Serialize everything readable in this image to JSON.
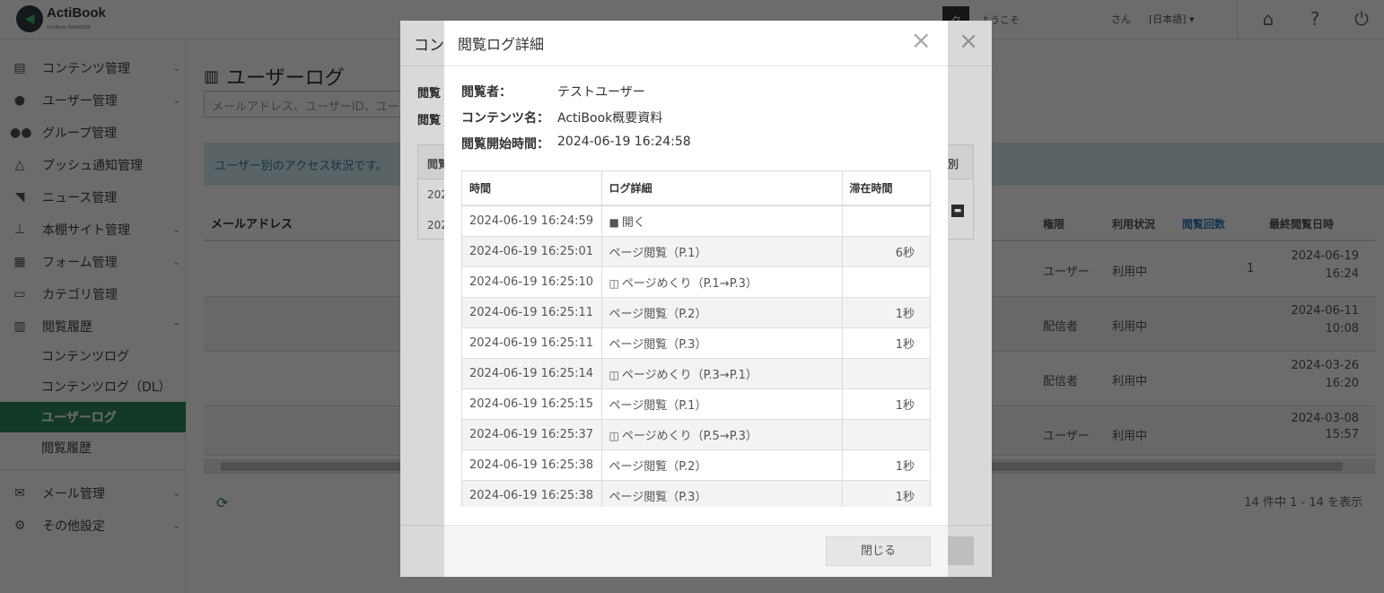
{
  "header": {
    "logo_text": "ActiBook",
    "logo_sub": "ActiBook MANAGER",
    "avatar": "ク",
    "welcome": "ようこそ",
    "san": "さん",
    "language": "[日本語] ▾",
    "icons": [
      "home-icon",
      "help-icon",
      "power-icon"
    ]
  },
  "sidebar": {
    "items": [
      {
        "label": "コンテンツ管理",
        "icon": "file-icon",
        "chevron": "⌄"
      },
      {
        "label": "ユーザー管理",
        "icon": "user-icon",
        "chevron": "⌄"
      },
      {
        "label": "グループ管理",
        "icon": "group-icon",
        "chevron": ""
      },
      {
        "label": "プッシュ通知管理",
        "icon": "bell-icon",
        "chevron": ""
      },
      {
        "label": "ニュース管理",
        "icon": "rss-icon",
        "chevron": ""
      },
      {
        "label": "本棚サイト管理",
        "icon": "sitemap-icon",
        "chevron": "⌄"
      },
      {
        "label": "フォーム管理",
        "icon": "form-icon",
        "chevron": "⌄"
      },
      {
        "label": "カテゴリ管理",
        "icon": "folder-icon",
        "chevron": ""
      },
      {
        "label": "閲覧履歴",
        "icon": "bar-chart-icon",
        "chevron": "⌃"
      }
    ],
    "subitems": [
      "コンテンツログ",
      "コンテンツログ（DL）",
      "ユーザーログ",
      "閲覧履歴"
    ],
    "active_subitem": "ユーザーログ",
    "bottom_items": [
      {
        "label": "メール管理",
        "icon": "mail-icon",
        "chevron": "⌄"
      },
      {
        "label": "その他設定",
        "icon": "gear-icon",
        "chevron": "⌄"
      }
    ]
  },
  "main": {
    "title": "ユーザーログ",
    "search_placeholder": "メールアドレス、ユーザーID、ユー",
    "info": "ユーザー別のアクセス状況です。",
    "col_email": "メールアドレス",
    "col_role": "権限",
    "col_status": "利用状況",
    "col_views": "閲覧回数",
    "col_last": "最終閲覧日時",
    "rows": [
      {
        "role": "ユーザー",
        "status": "利用中",
        "views": "1",
        "date": "2024-06-19",
        "time": "16:24"
      },
      {
        "role": "配信者",
        "status": "利用中",
        "views": "",
        "date": "2024-06-11",
        "time": "10:08"
      },
      {
        "role": "配信者",
        "status": "利用中",
        "views": "",
        "date": "2024-03-26",
        "time": "16:20"
      },
      {
        "role": "ユーザー",
        "status": "利用中",
        "views": "",
        "date": "2024-03-08",
        "time": "15:57"
      }
    ],
    "page_info": "14 件中 1 - 14 を表示"
  },
  "modal_back": {
    "title": "コン",
    "close": "×",
    "label1": "閲覧",
    "label2": "閲覧",
    "table_head": "閲覧",
    "table_tail": "別",
    "row1": "202",
    "row2": "202"
  },
  "modal": {
    "title": "閲覧ログ詳細",
    "close": "×",
    "viewer_label": "閲覧者：",
    "viewer_value": "テストユーザー",
    "content_label": "コンテンツ名：",
    "content_value": "ActiBook概要資料",
    "start_label": "閲覧開始時間：",
    "start_value": "2024-06-19 16:24:58",
    "columns": [
      "時間",
      "ログ詳細",
      "滞在時間"
    ],
    "logs": [
      {
        "time": "2024-06-19 16:24:59",
        "icon": "book-icon",
        "detail": "開く",
        "stay": ""
      },
      {
        "time": "2024-06-19 16:25:01",
        "icon": "",
        "detail": "ページ閲覧（P.1）",
        "stay": "6秒"
      },
      {
        "time": "2024-06-19 16:25:10",
        "icon": "page-flip-icon",
        "detail": "ページめくり（P.1→P.3）",
        "stay": ""
      },
      {
        "time": "2024-06-19 16:25:11",
        "icon": "",
        "detail": "ページ閲覧（P.2）",
        "stay": "1秒"
      },
      {
        "time": "2024-06-19 16:25:11",
        "icon": "",
        "detail": "ページ閲覧（P.3）",
        "stay": "1秒"
      },
      {
        "time": "2024-06-19 16:25:14",
        "icon": "page-flip-icon",
        "detail": "ページめくり（P.3→P.1）",
        "stay": ""
      },
      {
        "time": "2024-06-19 16:25:15",
        "icon": "",
        "detail": "ページ閲覧（P.1）",
        "stay": "1秒"
      },
      {
        "time": "2024-06-19 16:25:37",
        "icon": "page-flip-icon",
        "detail": "ページめくり（P.5→P.3）",
        "stay": ""
      },
      {
        "time": "2024-06-19 16:25:38",
        "icon": "",
        "detail": "ページ閲覧（P.2）",
        "stay": "1秒"
      },
      {
        "time": "2024-06-19 16:25:38",
        "icon": "",
        "detail": "ページ閲覧（P.3）",
        "stay": "1秒"
      }
    ],
    "close_button": "閉じる"
  }
}
